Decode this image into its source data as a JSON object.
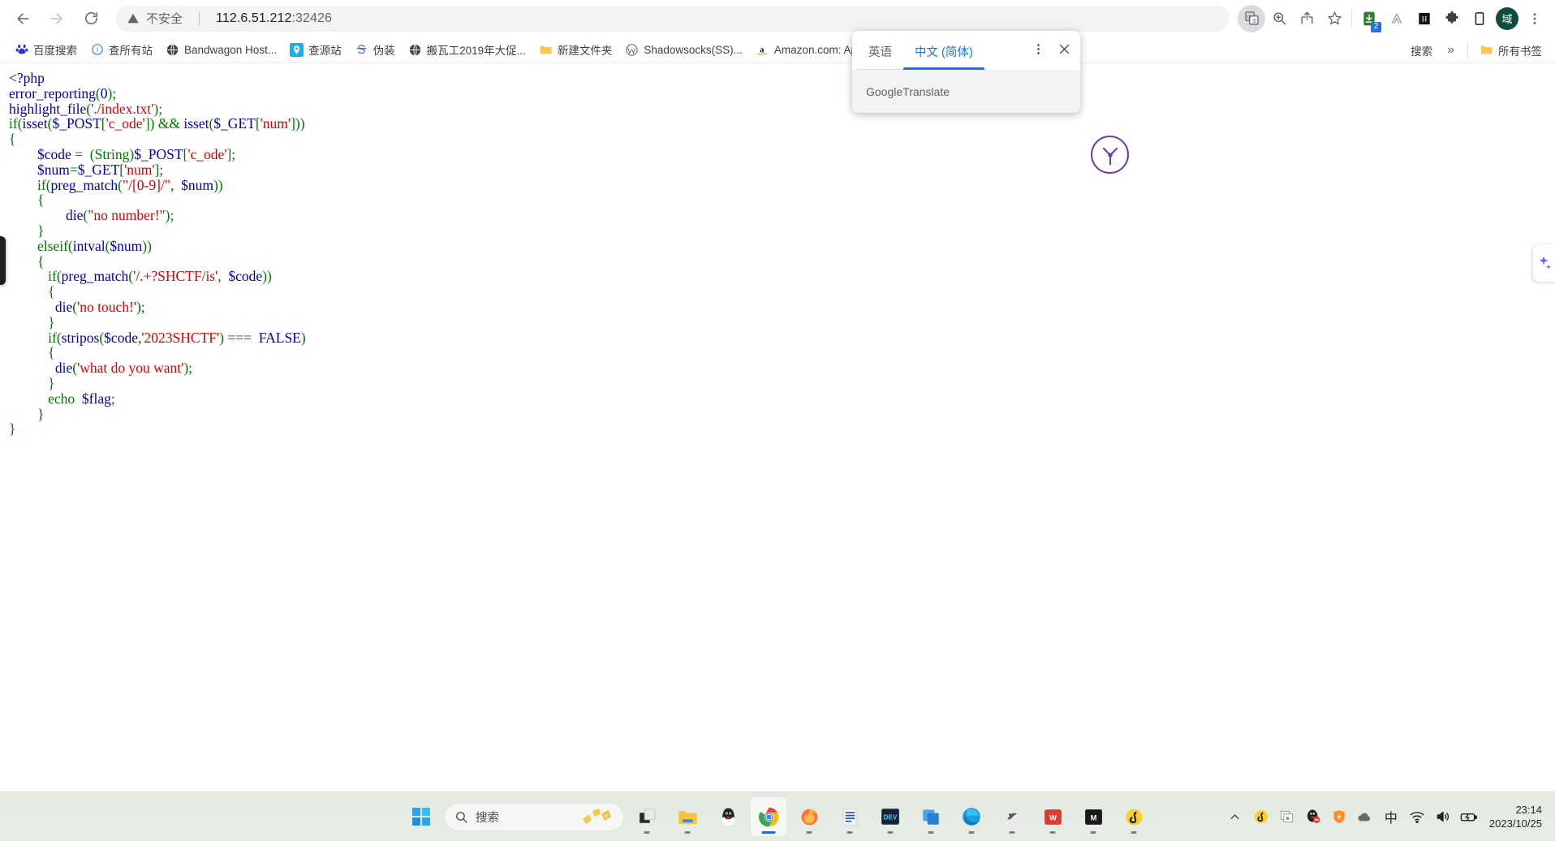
{
  "browser": {
    "nav": {
      "back_label": "Back",
      "forward_label": "Forward",
      "reload_label": "Reload"
    },
    "omnibox": {
      "security_label": "不安全",
      "url": "112.6.51.212",
      "port": ":32426"
    },
    "toolbar_icons": [
      {
        "name": "translate-icon",
        "label": "Google 翻译"
      },
      {
        "name": "zoom-icon",
        "label": "缩放"
      },
      {
        "name": "share-icon",
        "label": "分享"
      },
      {
        "name": "bookmark-star-icon",
        "label": "收藏此标签页"
      },
      {
        "name": "extension-downloader-icon",
        "label": "下载器扩展",
        "badge": "2"
      },
      {
        "name": "extension-adblock-icon",
        "label": "扩展 A"
      },
      {
        "name": "extension-hackbar-icon",
        "label": "HackBar"
      },
      {
        "name": "extensions-puzzle-icon",
        "label": "扩展程序"
      },
      {
        "name": "side-panel-icon",
        "label": "侧边栏"
      },
      {
        "name": "profile-avatar",
        "label": "域"
      },
      {
        "name": "chrome-menu-icon",
        "label": "自定义及控制"
      }
    ],
    "bookmarks": [
      {
        "label": "百度搜索",
        "icon": "baidu-icon"
      },
      {
        "label": "查所有站",
        "icon": "globe-f-icon"
      },
      {
        "label": "Bandwagon Host...",
        "icon": "globe-icon"
      },
      {
        "label": "查源站",
        "icon": "pin-icon"
      },
      {
        "label": "伪装",
        "icon": "s-icon"
      },
      {
        "label": "搬瓦工2019年大促...",
        "icon": "globe-icon"
      },
      {
        "label": "新建文件夹",
        "icon": "folder-icon"
      },
      {
        "label": "Shadowsocks(SS)...",
        "icon": "wordpress-icon"
      },
      {
        "label": "Amazon.com: Ap...",
        "icon": "amazon-icon"
      }
    ],
    "bookmarks_right": {
      "overflow_label": "搜索",
      "chevron": "»",
      "all_bookmarks_label": "所有书签"
    }
  },
  "translate_popup": {
    "tabs": [
      {
        "label": "英语",
        "selected": false
      },
      {
        "label": "中文 (简体)",
        "selected": true
      }
    ],
    "menu_icon": "more-vertical-icon",
    "close_icon": "close-icon",
    "footer": {
      "brand_g": "Google",
      "brand_rest": " Translate"
    }
  },
  "page": {
    "code_lines": [
      [
        {
          "t": "<?php",
          "c": "c-def"
        }
      ],
      [
        {
          "t": "error_reporting",
          "c": "c-def"
        },
        {
          "t": "(",
          "c": "c-kw"
        },
        {
          "t": "0",
          "c": "c-def"
        },
        {
          "t": ")",
          "c": "c-kw"
        },
        {
          "t": ";",
          "c": "c-kw"
        }
      ],
      [
        {
          "t": "highlight_file",
          "c": "c-def"
        },
        {
          "t": "(",
          "c": "c-kw"
        },
        {
          "t": "'./index.txt'",
          "c": "c-str"
        },
        {
          "t": ")",
          "c": "c-kw"
        },
        {
          "t": ";",
          "c": "c-kw"
        }
      ],
      [
        {
          "t": "if",
          "c": "c-kw"
        },
        {
          "t": "(",
          "c": "c-kw"
        },
        {
          "t": "isset",
          "c": "c-def"
        },
        {
          "t": "(",
          "c": "c-kw"
        },
        {
          "t": "$_POST",
          "c": "c-def"
        },
        {
          "t": "[",
          "c": "c-kw"
        },
        {
          "t": "'c_ode'",
          "c": "c-str"
        },
        {
          "t": "]) ",
          "c": "c-kw"
        },
        {
          "t": "&& ",
          "c": "c-kw"
        },
        {
          "t": "isset",
          "c": "c-def"
        },
        {
          "t": "(",
          "c": "c-kw"
        },
        {
          "t": "$_GET",
          "c": "c-def"
        },
        {
          "t": "[",
          "c": "c-kw"
        },
        {
          "t": "'num'",
          "c": "c-str"
        },
        {
          "t": "]))",
          "c": "c-kw"
        }
      ],
      [
        {
          "t": "{",
          "c": "c-kw"
        }
      ],
      [
        {
          "t": "        ",
          "c": "c-kw"
        },
        {
          "t": "$code ",
          "c": "c-def"
        },
        {
          "t": "= ",
          "c": "c-kw"
        },
        {
          "t": " (String)",
          "c": "c-kw"
        },
        {
          "t": "$_POST",
          "c": "c-def"
        },
        {
          "t": "[",
          "c": "c-kw"
        },
        {
          "t": "'c_ode'",
          "c": "c-str"
        },
        {
          "t": "];",
          "c": "c-kw"
        }
      ],
      [
        {
          "t": "        ",
          "c": "c-kw"
        },
        {
          "t": "$num",
          "c": "c-def"
        },
        {
          "t": "=",
          "c": "c-kw"
        },
        {
          "t": "$_GET",
          "c": "c-def"
        },
        {
          "t": "[",
          "c": "c-kw"
        },
        {
          "t": "'num'",
          "c": "c-str"
        },
        {
          "t": "];",
          "c": "c-kw"
        }
      ],
      [
        {
          "t": "        ",
          "c": "c-kw"
        },
        {
          "t": "if",
          "c": "c-kw"
        },
        {
          "t": "(",
          "c": "c-kw"
        },
        {
          "t": "preg_match",
          "c": "c-def"
        },
        {
          "t": "(",
          "c": "c-kw"
        },
        {
          "t": "\"/[0-9]/\"",
          "c": "c-str"
        },
        {
          "t": ", ",
          "c": "c-kw"
        },
        {
          "t": " $num",
          "c": "c-def"
        },
        {
          "t": "))",
          "c": "c-kw"
        }
      ],
      [
        {
          "t": "        {",
          "c": "c-kw"
        }
      ],
      [
        {
          "t": "                ",
          "c": "c-kw"
        },
        {
          "t": "die",
          "c": "c-def"
        },
        {
          "t": "(",
          "c": "c-kw"
        },
        {
          "t": "\"no number!\"",
          "c": "c-str"
        },
        {
          "t": ");",
          "c": "c-kw"
        }
      ],
      [
        {
          "t": "        }",
          "c": "c-kw"
        }
      ],
      [
        {
          "t": "        ",
          "c": "c-kw"
        },
        {
          "t": "elseif",
          "c": "c-kw"
        },
        {
          "t": "(",
          "c": "c-kw"
        },
        {
          "t": "intval",
          "c": "c-def"
        },
        {
          "t": "(",
          "c": "c-kw"
        },
        {
          "t": "$num",
          "c": "c-def"
        },
        {
          "t": "))",
          "c": "c-kw"
        }
      ],
      [
        {
          "t": "        {",
          "c": "c-kw"
        }
      ],
      [
        {
          "t": "           ",
          "c": "c-kw"
        },
        {
          "t": "if",
          "c": "c-kw"
        },
        {
          "t": "(",
          "c": "c-kw"
        },
        {
          "t": "preg_match",
          "c": "c-def"
        },
        {
          "t": "(",
          "c": "c-kw"
        },
        {
          "t": "'/.+?SHCTF/is'",
          "c": "c-str"
        },
        {
          "t": ", ",
          "c": "c-kw"
        },
        {
          "t": " $code",
          "c": "c-def"
        },
        {
          "t": "))",
          "c": "c-kw"
        }
      ],
      [
        {
          "t": "           {",
          "c": "c-kw"
        }
      ],
      [
        {
          "t": "             ",
          "c": "c-kw"
        },
        {
          "t": "die",
          "c": "c-def"
        },
        {
          "t": "(",
          "c": "c-kw"
        },
        {
          "t": "'no touch!'",
          "c": "c-str"
        },
        {
          "t": ");",
          "c": "c-kw"
        }
      ],
      [
        {
          "t": "           }",
          "c": "c-kw"
        }
      ],
      [
        {
          "t": "           ",
          "c": "c-kw"
        },
        {
          "t": "if",
          "c": "c-kw"
        },
        {
          "t": "(",
          "c": "c-kw"
        },
        {
          "t": "stripos",
          "c": "c-def"
        },
        {
          "t": "(",
          "c": "c-kw"
        },
        {
          "t": "$code",
          "c": "c-def"
        },
        {
          "t": ",",
          "c": "c-kw"
        },
        {
          "t": "'2023SHCTF'",
          "c": "c-str"
        },
        {
          "t": ") ",
          "c": "c-kw"
        },
        {
          "t": "=== ",
          "c": "c-kw"
        },
        {
          "t": " FALSE",
          "c": "c-def"
        },
        {
          "t": ")",
          "c": "c-kw"
        }
      ],
      [
        {
          "t": "           {",
          "c": "c-kw"
        }
      ],
      [
        {
          "t": "             ",
          "c": "c-kw"
        },
        {
          "t": "die",
          "c": "c-def"
        },
        {
          "t": "(",
          "c": "c-kw"
        },
        {
          "t": "'what do you want'",
          "c": "c-str"
        },
        {
          "t": ");",
          "c": "c-kw"
        }
      ],
      [
        {
          "t": "           }",
          "c": "c-kw"
        }
      ],
      [
        {
          "t": "           ",
          "c": "c-kw"
        },
        {
          "t": "echo ",
          "c": "c-kw"
        },
        {
          "t": " $flag",
          "c": "c-def"
        },
        {
          "t": ";",
          "c": "c-kw"
        }
      ],
      [
        {
          "t": "        }",
          "c": "c-kw"
        }
      ],
      [
        {
          "t": "}",
          "c": "c-kw"
        }
      ]
    ]
  },
  "taskbar": {
    "start_label": "开始",
    "search_placeholder": "搜索",
    "items": [
      {
        "name": "taskbar-task-view",
        "label": "任务视图"
      },
      {
        "name": "taskbar-file-explorer",
        "label": "文件资源管理器"
      },
      {
        "name": "taskbar-qq",
        "label": "QQ"
      },
      {
        "name": "taskbar-chrome",
        "label": "Google Chrome"
      },
      {
        "name": "taskbar-firefox",
        "label": "Firefox"
      },
      {
        "name": "taskbar-word",
        "label": "Word"
      },
      {
        "name": "taskbar-dev",
        "label": "DEV"
      },
      {
        "name": "taskbar-vmware",
        "label": "VMware"
      },
      {
        "name": "taskbar-edge",
        "label": "Microsoft Edge"
      },
      {
        "name": "taskbar-hashcat",
        "label": "工具"
      },
      {
        "name": "taskbar-wps",
        "label": "WPS"
      },
      {
        "name": "taskbar-music",
        "label": "音乐"
      },
      {
        "name": "taskbar-netease",
        "label": "网易云音乐"
      }
    ],
    "tray": [
      {
        "name": "tray-chevron-up-icon",
        "label": "显示隐藏的图标"
      },
      {
        "name": "tray-netease-icon",
        "label": "网易云音乐"
      },
      {
        "name": "tray-screen-recorder-icon",
        "label": "录屏"
      },
      {
        "name": "tray-qq-icon",
        "label": "QQ"
      },
      {
        "name": "tray-shield-icon",
        "label": "安全卫士"
      },
      {
        "name": "tray-cloud-icon",
        "label": "云盘"
      },
      {
        "name": "tray-ime-icon",
        "label": "中"
      },
      {
        "name": "tray-wifi-icon",
        "label": "网络"
      },
      {
        "name": "tray-volume-icon",
        "label": "音量"
      },
      {
        "name": "tray-battery-icon",
        "label": "电池"
      }
    ],
    "clock": {
      "time": "23:14",
      "date": "2023/10/25"
    }
  }
}
